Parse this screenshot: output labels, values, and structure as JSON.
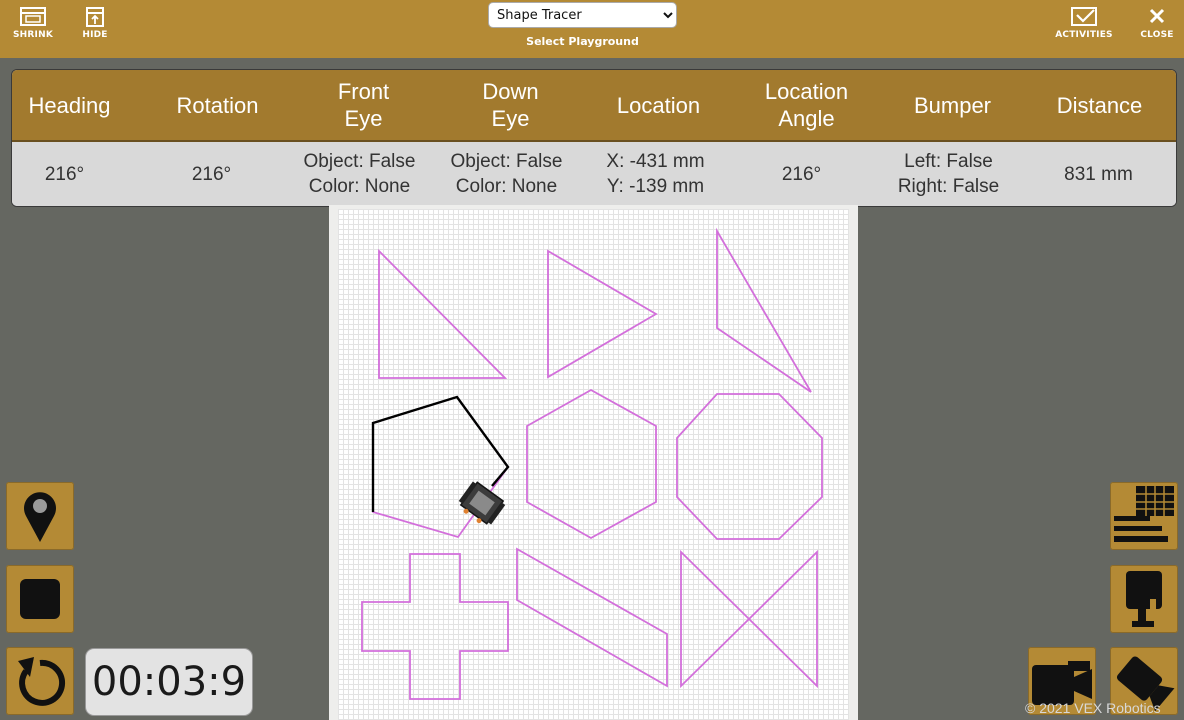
{
  "toolbar": {
    "shrink_label": "SHRINK",
    "hide_label": "HIDE",
    "activities_label": "ACTIVITIES",
    "close_label": "CLOSE",
    "playground_select": {
      "selected": "Shape Tracer",
      "caption": "Select Playground"
    }
  },
  "sensors": {
    "headers": [
      [
        "Heading"
      ],
      [
        "Rotation"
      ],
      [
        "Front",
        "Eye"
      ],
      [
        "Down",
        "Eye"
      ],
      [
        "Location"
      ],
      [
        "Location",
        "Angle"
      ],
      [
        "Bumper"
      ],
      [
        "Distance"
      ]
    ],
    "values": [
      [
        "216°"
      ],
      [
        "216°"
      ],
      [
        "Object: False",
        "Color: None"
      ],
      [
        "Object: False",
        "Color: None"
      ],
      [
        "X: -431 mm",
        "Y: -139 mm"
      ],
      [
        "216°"
      ],
      [
        "Left: False",
        "Right: False"
      ],
      [
        "831 mm"
      ]
    ]
  },
  "timer": {
    "value": "00:03:9"
  },
  "footer": {
    "copyright": "© 2021 VEX Robotics"
  },
  "icons": {
    "shrink": "shrink-window-icon",
    "hide": "hide-panel-icon",
    "activities": "activities-check-icon",
    "close": "close-x-icon",
    "location": "map-pin-icon",
    "stop": "stop-square-icon",
    "reset": "reset-arrow-icon",
    "table": "data-table-icon",
    "cam_top": "camera-top-icon",
    "cam_side": "camera-side-icon",
    "cam_angle": "camera-angle-icon"
  },
  "colors": {
    "toolbar": "#b48a35",
    "table_header": "#a27a2e",
    "shape_outline": "#d36fdb",
    "trace_line": "#000000",
    "background": "#656761"
  }
}
